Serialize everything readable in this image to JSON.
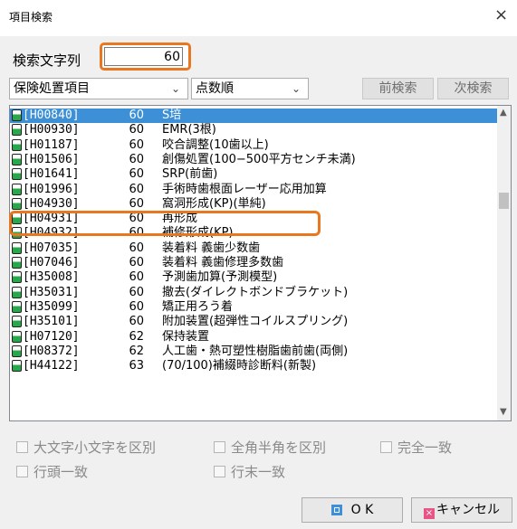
{
  "window": {
    "title": "項目検索",
    "close_symbol": "×"
  },
  "search": {
    "label": "検索文字列",
    "value": "60"
  },
  "filters": {
    "category": "保険処置項目",
    "sort": "点数順",
    "prev_label": "前検索",
    "next_label": "次検索"
  },
  "list": {
    "items": [
      {
        "code": "[H00840]",
        "points": "60",
        "name": "S培"
      },
      {
        "code": "[H00930]",
        "points": "60",
        "name": "EMR(3根)"
      },
      {
        "code": "[H01187]",
        "points": "60",
        "name": "咬合調整(10歯以上)"
      },
      {
        "code": "[H01506]",
        "points": "60",
        "name": "創傷処置(100−500平方センチ未満)"
      },
      {
        "code": "[H01641]",
        "points": "60",
        "name": "SRP(前歯)"
      },
      {
        "code": "[H01996]",
        "points": "60",
        "name": "手術時歯根面レーザー応用加算"
      },
      {
        "code": "[H04930]",
        "points": "60",
        "name": "窩洞形成(KP)(単純)"
      },
      {
        "code": "[H04931]",
        "points": "60",
        "name": "再形成"
      },
      {
        "code": "[H04932]",
        "points": "60",
        "name": "補修形成(KP)"
      },
      {
        "code": "[H07035]",
        "points": "60",
        "name": "装着料 義歯少数歯"
      },
      {
        "code": "[H07046]",
        "points": "60",
        "name": "装着料 義歯修理多数歯"
      },
      {
        "code": "[H35008]",
        "points": "60",
        "name": "予測歯加算(予測模型)"
      },
      {
        "code": "[H35031]",
        "points": "60",
        "name": "撤去(ダイレクトボンドブラケット)"
      },
      {
        "code": "[H35099]",
        "points": "60",
        "name": "矯正用ろう着"
      },
      {
        "code": "[H35101]",
        "points": "60",
        "name": "附加装置(超弾性コイルスプリング)"
      },
      {
        "code": "[H07120]",
        "points": "62",
        "name": "保持装置"
      },
      {
        "code": "[H08372]",
        "points": "62",
        "name": "人工歯・熱可塑性樹脂歯前歯(両側)"
      },
      {
        "code": "[H44122]",
        "points": "63",
        "name": "(70/100)補綴時診断料(新製)"
      }
    ]
  },
  "options": {
    "case_sensitive": "大文字小文字を区別",
    "width_sensitive": "全角半角を区別",
    "exact_match": "完全一致",
    "prefix_match": "行頭一致",
    "suffix_match": "行末一致"
  },
  "buttons": {
    "ok": "O K",
    "cancel": "キャンセル",
    "cancel_icon": "×"
  },
  "colors": {
    "highlight": "#e9771f",
    "selection": "#3d8fd6"
  }
}
